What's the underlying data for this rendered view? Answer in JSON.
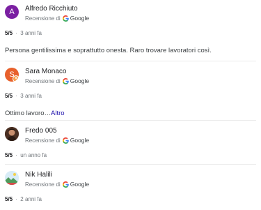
{
  "reviews": [
    {
      "avatar_letter": "A",
      "avatar_color": "#7b1fa2",
      "name": "Alfredo Ricchiuto",
      "source_prefix": "Recensione di",
      "source_name": "Google",
      "score": "5/5",
      "separator": "·",
      "time": "3 anni fa",
      "text": "Persona gentilissima e soprattutto onesta. Raro trovare lavoratori così."
    },
    {
      "avatar_letter": "S",
      "avatar_color": "#e8612c",
      "name": "Sara Monaco",
      "source_prefix": "Recensione di",
      "source_name": "Google",
      "score": "5/5",
      "separator": "·",
      "time": "3 anni fa",
      "text": "Ottimo lavoro…",
      "more_label": "Altro"
    },
    {
      "avatar_icon": "profile-photo-icon",
      "name": "Fredo 005",
      "source_prefix": "Recensione di",
      "source_name": "Google",
      "score": "5/5",
      "separator": "·",
      "time": "un anno fa"
    },
    {
      "avatar_icon": "landscape-photo-icon",
      "name": "Nik Halili",
      "source_prefix": "Recensione di",
      "source_name": "Google",
      "score": "5/5",
      "separator": "·",
      "time": "2 anni fa"
    }
  ]
}
